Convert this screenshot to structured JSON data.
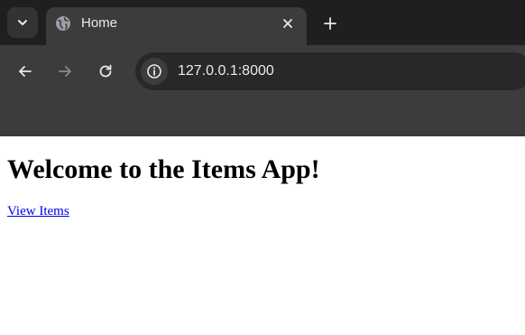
{
  "browser": {
    "tabs": [
      {
        "title": "Home",
        "active": true
      }
    ],
    "address_bar": {
      "url": "127.0.0.1:8000"
    },
    "colors": {
      "tabstrip_bg": "#1f1f1f",
      "toolbar_bg": "#3c3c3c",
      "omnibox_bg": "#282828",
      "text": "#e8eaed"
    }
  },
  "icons": {
    "tab_search": "chevron-down-icon",
    "favicon": "globe-icon",
    "tab_close": "close-icon",
    "new_tab": "plus-icon",
    "back": "arrow-left-icon",
    "forward": "arrow-right-icon",
    "reload": "reload-icon",
    "site_info": "info-icon"
  },
  "page": {
    "heading": "Welcome to the Items App!",
    "link_label": "View Items",
    "link_color": "#0000ee"
  }
}
